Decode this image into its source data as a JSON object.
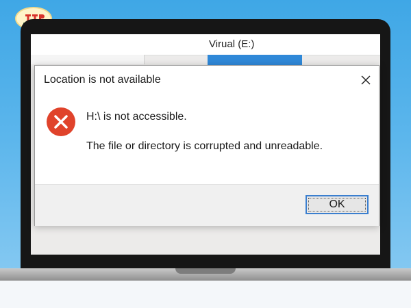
{
  "background_window": {
    "title": "Virual (E:)"
  },
  "dialog": {
    "title": "Location is not available",
    "message_primary": "H:\\ is not accessible.",
    "message_secondary": "The file or directory is corrupted and unreadable.",
    "ok_label": "OK",
    "icon": "error-icon",
    "accent_color": "#e0432b"
  },
  "logo": {
    "icon": "logo-icon"
  }
}
